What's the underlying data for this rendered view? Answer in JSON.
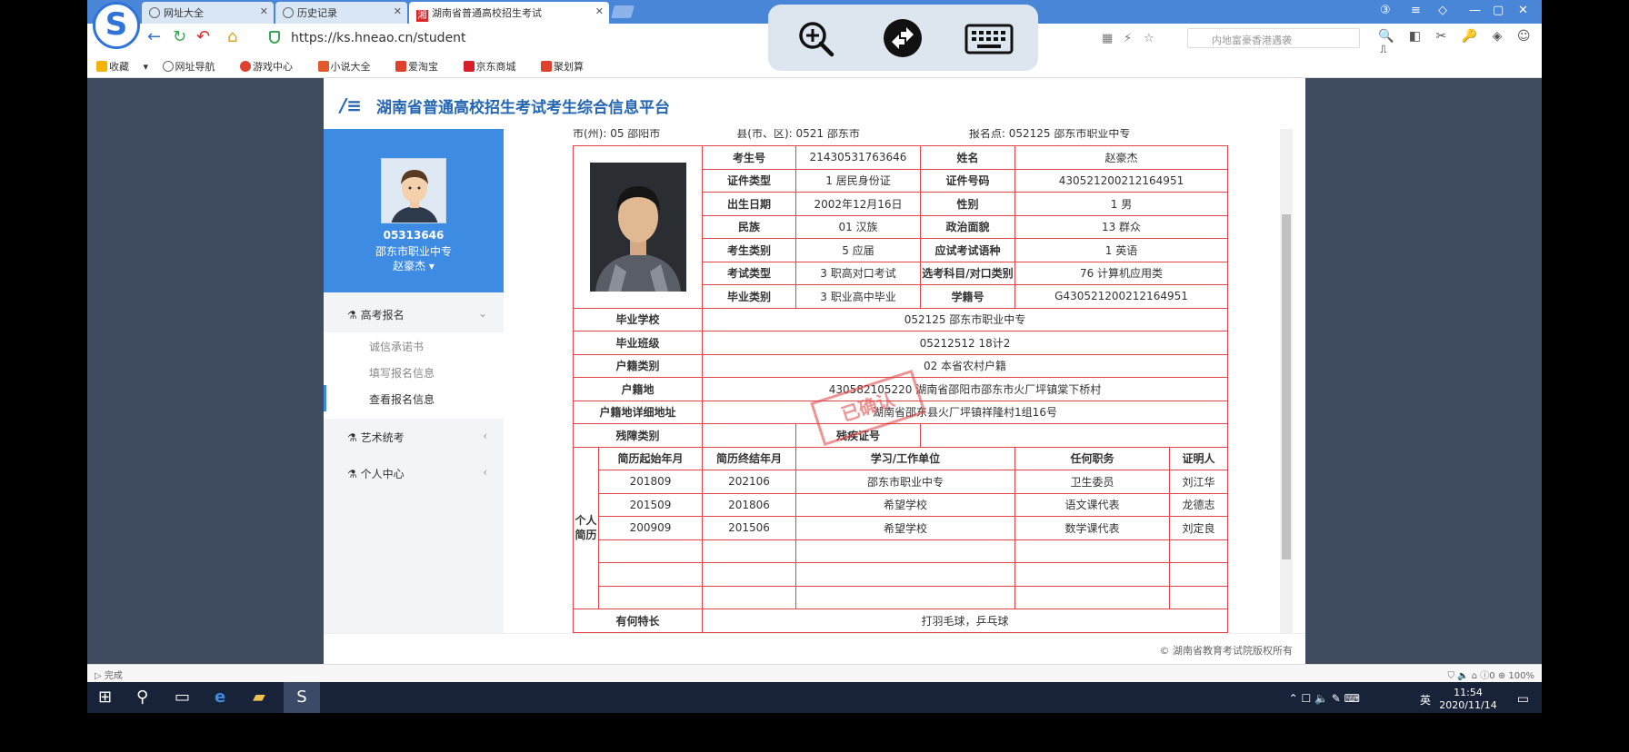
{
  "tabs": [
    {
      "label": "网址大全"
    },
    {
      "label": "历史记录"
    },
    {
      "label": "湖南省普通高校招生考试"
    }
  ],
  "tab_red_icon": "湘",
  "address": {
    "url": "https://ks.hneao.cn/student",
    "search_placeholder": "内地富豪香港遇袭"
  },
  "bookmarks": [
    "收藏",
    "网址导航",
    "游戏中心",
    "小说大全",
    "爱淘宝",
    "京东商城",
    "聚划算"
  ],
  "header": {
    "title": "湖南省普通高校招生考试考生综合信息平台"
  },
  "profile": {
    "id": "05313646",
    "school": "邵东市职业中专",
    "name": "赵豪杰 ▾"
  },
  "menu": {
    "gaokao": "高考报名",
    "sub": [
      "诚信承诺书",
      "填写报名信息",
      "查看报名信息"
    ],
    "art": "艺术统考",
    "personal": "个人中心"
  },
  "top_row": "市(州): 05 邵阳市　　　　　　　县(市、区): 0521 邵东市　　　　　　　　　　报名点: 052125 邵东市职业中专",
  "info": {
    "kaoshenghao_l": "考生号",
    "kaoshenghao": "21430531763646",
    "xingming_l": "姓名",
    "xingming": "赵豪杰",
    "zjlx_l": "证件类型",
    "zjlx": "1 居民身份证",
    "zjhm_l": "证件号码",
    "zjhm": "430521200212164951",
    "csrq_l": "出生日期",
    "csrq": "2002年12月16日",
    "xb_l": "性别",
    "xb": "1 男",
    "mz_l": "民族",
    "mz": "01 汉族",
    "zzmm_l": "政治面貌",
    "zzmm": "13 群众",
    "kslb_l": "考生类别",
    "kslb": "5 应届",
    "wy_l": "应试考试语种",
    "wy": "1 英语",
    "kslx_l": "考试类型",
    "kslx": "3 职高对口考试",
    "xkkm_l": "选考科目/对口类别",
    "xkkm": "76 计算机应用类",
    "bylb_l": "毕业类别",
    "bylb": "3 职业高中毕业",
    "xjh_l": "学籍号",
    "xjh": "G430521200212164951",
    "byxx_l": "毕业学校",
    "byxx": "052125 邵东市职业中专",
    "bybj_l": "毕业班级",
    "bybj": "05212512 18计2",
    "hjlb_l": "户籍类别",
    "hjlb": "02 本省农村户籍",
    "hjd_l": "户籍地",
    "hjd": "430582105220 湖南省邵阳市邵东市火厂坪镇棠下桥村",
    "hjxx_l": "户籍地详细地址",
    "hjxx": "湖南省邵东县火厂坪镇祥隆村1组16号",
    "cjlb_l": "残障类别",
    "cjzh_l": "残疾证号",
    "jl_l": "个人简历",
    "jl_headers": [
      "简历起始年月",
      "简历终结年月",
      "学习/工作单位",
      "任何职务",
      "证明人"
    ],
    "jl_rows": [
      [
        "201809",
        "202106",
        "邵东市职业中专",
        "卫生委员",
        "刘江华"
      ],
      [
        "201509",
        "201806",
        "希望学校",
        "语文课代表",
        "龙德志"
      ],
      [
        "200909",
        "201506",
        "希望学校",
        "数学课代表",
        "刘定良"
      ]
    ],
    "tc_l": "有何特长",
    "tc": "打羽毛球，乒乓球"
  },
  "stamp": "已确认",
  "footer": "© 湖南省教育考试院版权所有",
  "status": {
    "left": "完成",
    "zoom": "100%",
    "count": "0"
  },
  "taskbar": {
    "time": "11:54",
    "date": "2020/11/14",
    "ime": "英"
  }
}
